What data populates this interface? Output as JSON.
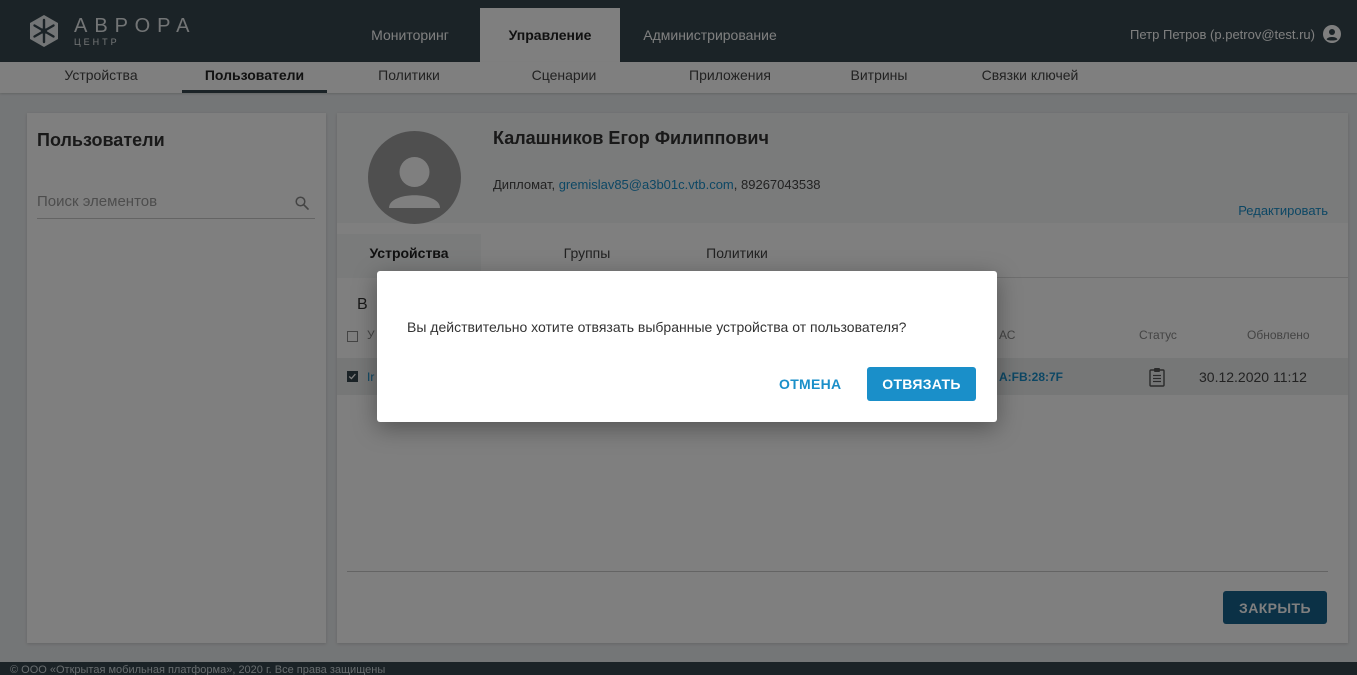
{
  "brand": {
    "name": "АВРОРА",
    "sub": "ЦЕНТР",
    "logo_icon": "aurora-logo-icon"
  },
  "topnav": {
    "tabs": [
      "Мониторинг",
      "Управление",
      "Администрирование"
    ],
    "active": "Управление"
  },
  "user": {
    "label": "Петр Петров (p.petrov@test.ru)",
    "icon": "account-circle-icon"
  },
  "subnav": {
    "tabs": [
      "Устройства",
      "Пользователи",
      "Политики",
      "Сценарии",
      "Приложения",
      "Витрины",
      "Связки ключей"
    ],
    "active": "Пользователи"
  },
  "left": {
    "title": "Пользователи",
    "search_placeholder": "Поиск элементов",
    "search_icon": "search-icon"
  },
  "profile": {
    "name": "Калашников Егор Филиппович",
    "role": "Дипломат",
    "email": "gremislav85@a3b01c.vtb.com",
    "phone": "89267043538",
    "edit_label": "Редактировать",
    "sep1": ", ",
    "sep2": ", "
  },
  "profile_tabs": {
    "tabs": [
      "Устройства",
      "Группы",
      "Политики"
    ],
    "active": "Устройства"
  },
  "devices": {
    "title_visible": "В",
    "headers": {
      "col1_visible": "У",
      "mac_visible": "АС",
      "status": "Статус",
      "updated": "Обновлено"
    },
    "rows": [
      {
        "name_visible": "Ir",
        "mac_visible": "A:FB:28:7F",
        "status_icon": "clipboard-icon",
        "updated": "30.12.2020 11:12",
        "checked": true
      }
    ]
  },
  "close_label": "ЗАКРЫТЬ",
  "footer": "© ООО «Открытая мобильная платформа», 2020 г. Все права защищены",
  "dialog": {
    "message": "Вы действительно хотите отвязать выбранные устройства от пользователя?",
    "cancel_label": "ОТМЕНА",
    "confirm_label": "ОТВЯЗАТЬ"
  },
  "colors": {
    "header": "#37474f",
    "accent": "#1a8fc9",
    "close_button": "#17628c",
    "background": "#e9ecee"
  }
}
